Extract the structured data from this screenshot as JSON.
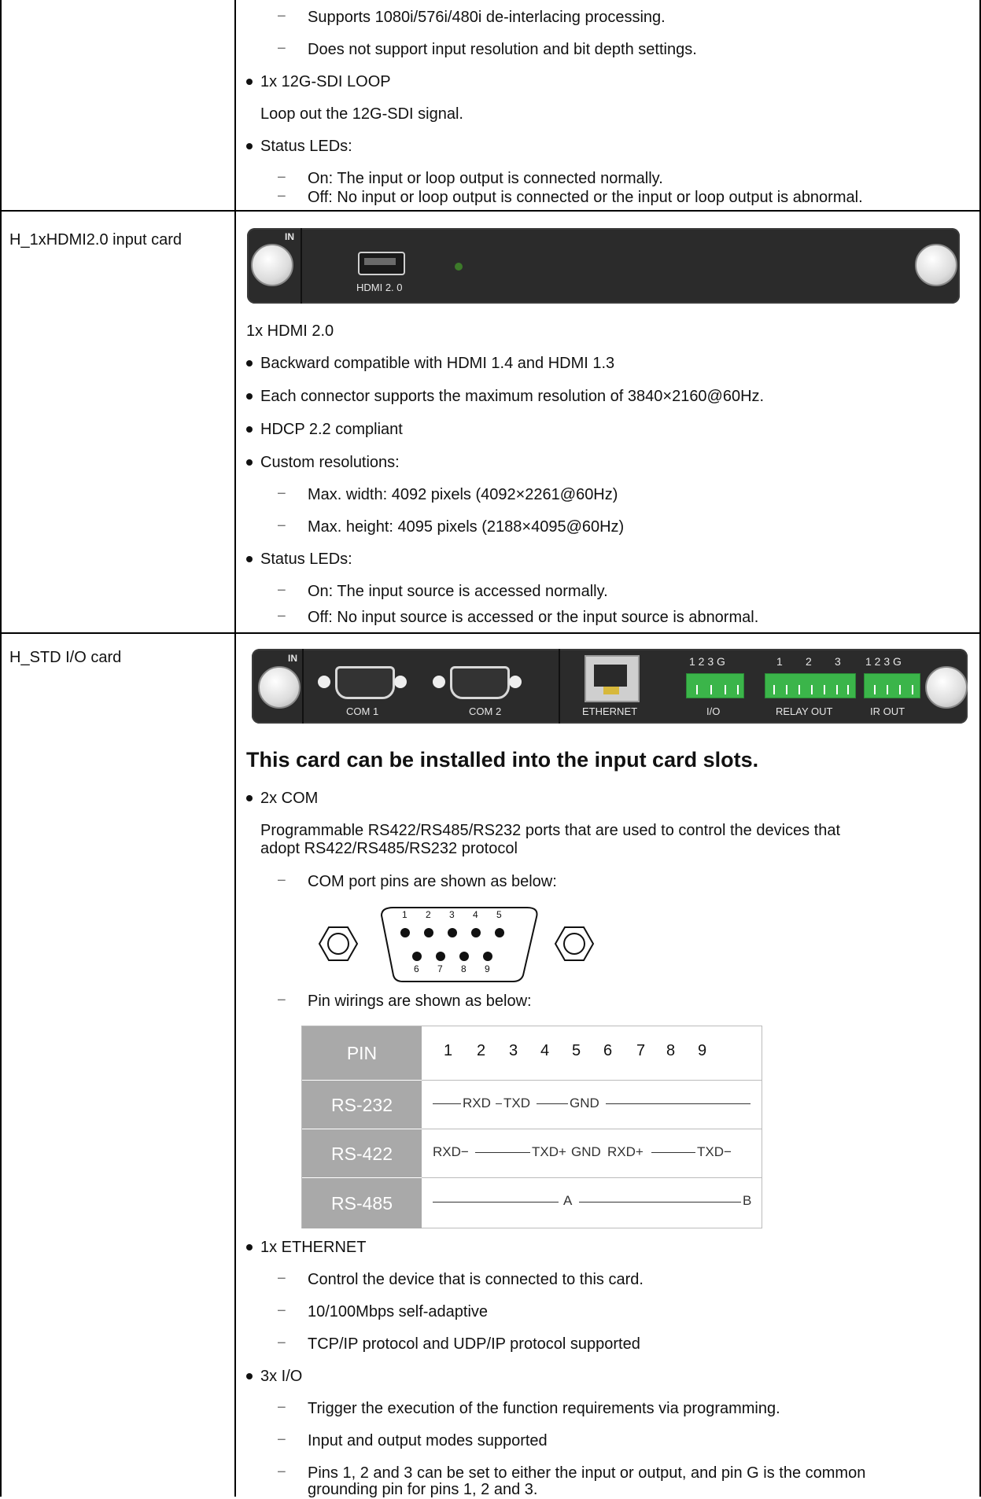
{
  "row0": {
    "lines": [
      "Supports 1080i/576i/480i de-interlacing processing.",
      "Does not support input resolution and bit depth settings.",
      "1x 12G-SDI LOOP",
      "Loop out the 12G-SDI signal.",
      "Status LEDs:",
      "On: The input or loop output is connected normally.",
      "Off: No input or loop output is connected or the input or loop output is abnormal."
    ]
  },
  "row1": {
    "label": "H_1xHDMI2.0 input card",
    "panel": {
      "in_label": "IN",
      "port_label": "HDMI 2. 0"
    },
    "title": "1x HDMI 2.0",
    "bullets": [
      "Backward compatible with HDMI 1.4 and HDMI 1.3",
      "Each connector supports the maximum resolution of 3840×2160@60Hz.",
      "HDCP 2.2 compliant",
      "Custom resolutions:",
      "Status LEDs:"
    ],
    "res_subs": [
      "Max. width: 4092 pixels (4092×2261@60Hz)",
      "Max. height: 4095 pixels (2188×4095@60Hz)"
    ],
    "led_subs": [
      "On: The input source is accessed normally.",
      "Off: No input source is accessed or the input source is abnormal."
    ]
  },
  "row2": {
    "label": "H_STD I/O card",
    "panel": {
      "in_label": "IN",
      "com1": "COM 1",
      "com2": "COM 2",
      "ethernet": "ETHERNET",
      "io": "I/O",
      "relay": "RELAY OUT",
      "ir": "IR OUT",
      "io_pins": "1 2 3 G",
      "relay_pins": [
        "1",
        "2",
        "3"
      ],
      "ir_pins": "1 2 3 G"
    },
    "heading": "This card can be installed into the input card slots.",
    "com_bullet": "2x COM",
    "com_desc_1": "Programmable RS422/RS485/RS232 ports that are used to control the devices that",
    "com_desc_2": "adopt RS422/RS485/RS232 protocol",
    "com_pins_caption": "COM port pins are shown as below:",
    "connector_top_pins": [
      "1",
      "2",
      "3",
      "4",
      "5"
    ],
    "connector_bottom_pins": [
      "6",
      "7",
      "8",
      "9"
    ],
    "wiring_caption": "Pin wirings are shown as below:",
    "pin_table": {
      "head": "PIN",
      "numbers": [
        "1",
        "2",
        "3",
        "4",
        "5",
        "6",
        "7",
        "8",
        "9"
      ],
      "rows": [
        {
          "name": "RS-232",
          "rxd": "RXD",
          "txd": "TXD",
          "gnd": "GND"
        },
        {
          "name": "RS-422",
          "rxd_minus": "RXD−",
          "txd_plus": "TXD+",
          "gnd": "GND",
          "rxd_plus": "RXD+",
          "txd_minus": "TXD−"
        },
        {
          "name": "RS-485",
          "a": "A",
          "b": "B"
        }
      ]
    },
    "eth_bullet": "1x ETHERNET",
    "eth_subs": [
      "Control the device that is connected to this card.",
      "10/100Mbps self-adaptive",
      "TCP/IP protocol and UDP/IP protocol supported"
    ],
    "io_bullet": "3x I/O",
    "io_subs": [
      "Trigger the execution of the function requirements via programming.",
      "Input and output modes supported",
      "Pins 1, 2 and 3 can be set to either the input or output, and pin G is the common"
    ],
    "io_sub_cont": "grounding pin for pins 1, 2 and 3."
  }
}
